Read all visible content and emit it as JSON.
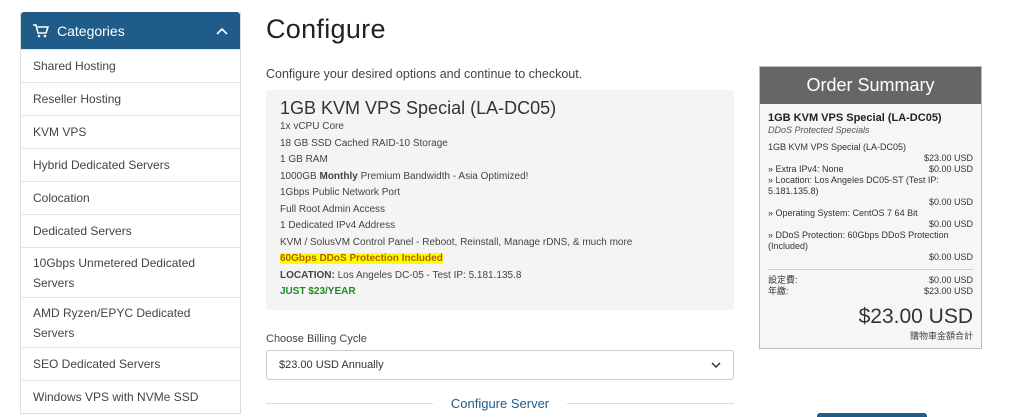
{
  "sidebar": {
    "title": "Categories",
    "items": [
      "Shared Hosting",
      "Reseller Hosting",
      "KVM VPS",
      "Hybrid Dedicated Servers",
      "Colocation",
      "Dedicated Servers",
      "10Gbps Unmetered Dedicated Servers",
      "AMD Ryzen/EPYC Dedicated Servers",
      "SEO Dedicated Servers",
      "Windows VPS with NVMe SSD"
    ]
  },
  "main": {
    "title": "Configure",
    "subtitle": "Configure your desired options and continue to checkout.",
    "product": {
      "name": "1GB KVM VPS Special (LA-DC05)",
      "lines": [
        "1x vCPU Core",
        "18 GB SSD Cached RAID-10 Storage",
        "1 GB RAM"
      ],
      "bandwidth_pre": "1000GB ",
      "bandwidth_bold": "Monthly",
      "bandwidth_post": " Premium Bandwidth - Asia Optimized!",
      "lines2": [
        "1Gbps Public Network Port",
        "Full Root Admin Access",
        "1 Dedicated IPv4 Address",
        "KVM / SolusVM Control Panel - Reboot, Reinstall, Manage rDNS, & much more"
      ],
      "ddos": "60Gbps DDoS Protection Included",
      "location_label": "LOCATION:",
      "location_value": " Los Angeles DC-05 - Test IP: 5.181.135.8",
      "price_line": "JUST $23/YEAR"
    },
    "billing": {
      "label": "Choose Billing Cycle",
      "selected": "$23.00 USD Annually"
    },
    "section_heading": "Configure Server"
  },
  "summary": {
    "title": "Order Summary",
    "product": "1GB KVM VPS Special (LA-DC05)",
    "group": "DDoS Protected Specials",
    "base_name": "1GB KVM VPS Special (LA-DC05)",
    "base_price": "$23.00 USD",
    "extra_ipv4": "» Extra IPv4: None",
    "extra_ipv4_price": "$0.00 USD",
    "location": "» Location: Los Angeles DC05-ST (Test IP: 5.181.135.8)",
    "location_price": "$0.00 USD",
    "os": "» Operating System: CentOS 7 64 Bit",
    "os_price": "$0.00 USD",
    "ddos": "» DDoS Protection: 60Gbps DDoS Protection (Included)",
    "ddos_price": "$0.00 USD",
    "setup_label": "設定費:",
    "setup_price": "$0.00 USD",
    "annual_label": "年繳:",
    "annual_price": "$23.00 USD",
    "total": "$23.00 USD",
    "total_label": "購物車金額合計"
  },
  "colors": {
    "accent": "#1f5c8a",
    "summary_header": "#666666",
    "highlight": "#ffff00",
    "green": "#1f8a1f"
  }
}
